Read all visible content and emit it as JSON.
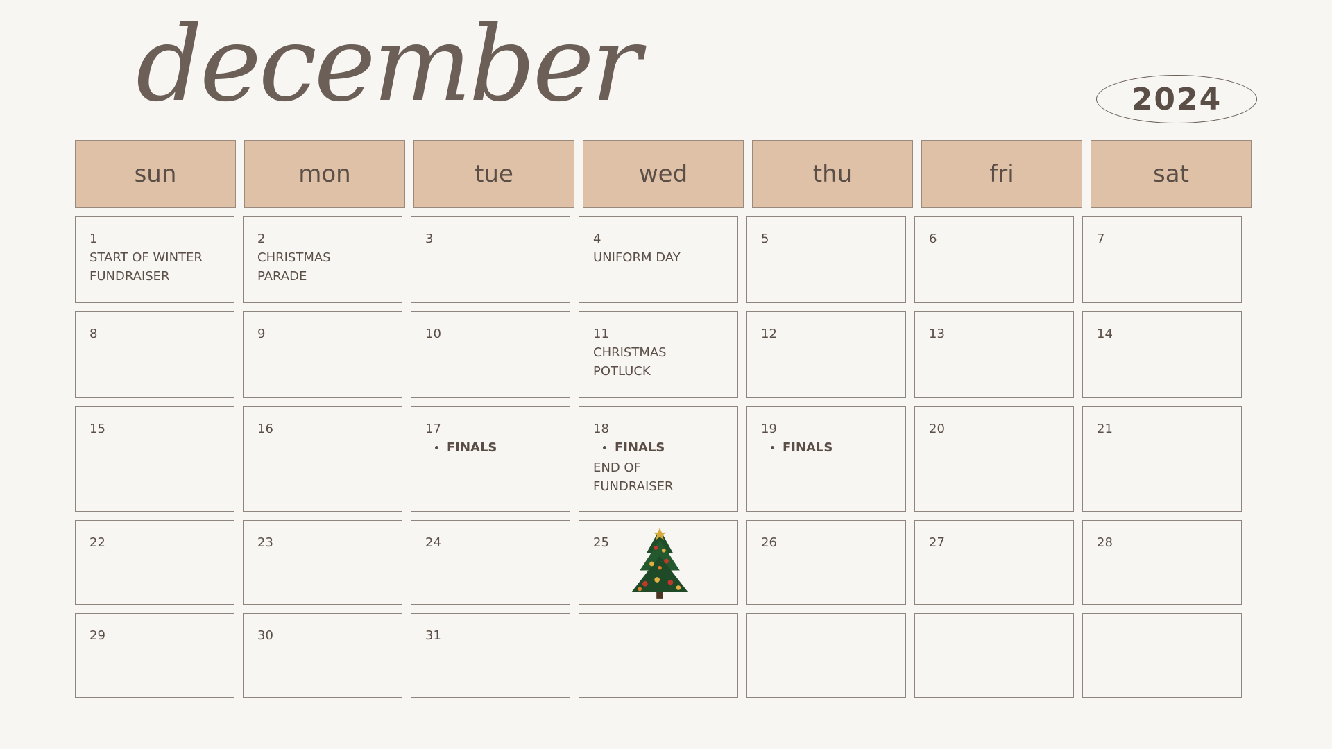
{
  "calendar": {
    "month": "december",
    "year": "2024",
    "weekdays": [
      "sun",
      "mon",
      "tue",
      "wed",
      "thu",
      "fri",
      "sat"
    ],
    "weeks": [
      [
        {
          "day": "1",
          "events": [
            "START OF WINTER",
            "FUNDRAISER"
          ]
        },
        {
          "day": "2",
          "events": [
            "CHRISTMAS",
            "PARADE"
          ]
        },
        {
          "day": "3"
        },
        {
          "day": "4",
          "events": [
            "UNIFORM DAY"
          ]
        },
        {
          "day": "5"
        },
        {
          "day": "6"
        },
        {
          "day": "7"
        }
      ],
      [
        {
          "day": "8"
        },
        {
          "day": "9"
        },
        {
          "day": "10"
        },
        {
          "day": "11",
          "events": [
            "CHRISTMAS",
            "POTLUCK"
          ]
        },
        {
          "day": "12"
        },
        {
          "day": "13"
        },
        {
          "day": "14"
        }
      ],
      [
        {
          "day": "15"
        },
        {
          "day": "16"
        },
        {
          "day": "17",
          "bullets": [
            "FINALS"
          ]
        },
        {
          "day": "18",
          "bullets": [
            "FINALS"
          ],
          "events": [
            "END OF",
            "FUNDRAISER"
          ]
        },
        {
          "day": "19",
          "bullets": [
            "FINALS"
          ]
        },
        {
          "day": "20"
        },
        {
          "day": "21"
        }
      ],
      [
        {
          "day": "22"
        },
        {
          "day": "23"
        },
        {
          "day": "24"
        },
        {
          "day": "25",
          "icon": "christmas-tree-icon"
        },
        {
          "day": "26"
        },
        {
          "day": "27"
        },
        {
          "day": "28"
        }
      ],
      [
        {
          "day": "29"
        },
        {
          "day": "30"
        },
        {
          "day": "31"
        },
        {
          "day": ""
        },
        {
          "day": ""
        },
        {
          "day": ""
        },
        {
          "day": ""
        }
      ]
    ]
  },
  "colors": {
    "background": "#f8f6f2",
    "header_fill": "#dec1a7",
    "text": "#5a4e46",
    "border": "#8f857d"
  }
}
